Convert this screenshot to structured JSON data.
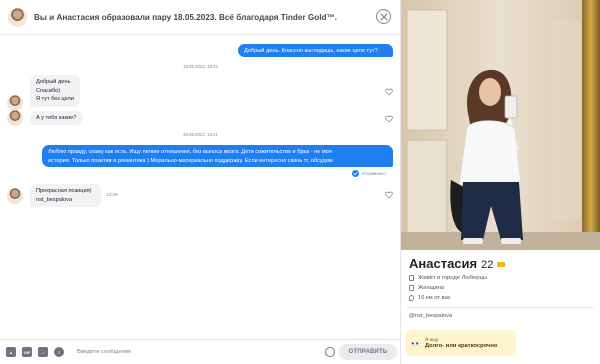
{
  "header": {
    "match_text": "Вы и Анастасия образовали пару 18.05.2023. Всё благодаря Tinder Gold™."
  },
  "messages": {
    "out_1": "Добрый день. Классно выглядишь, какие цели тут?",
    "date_1": "18.05.2023, 18:42",
    "in_1_line1": "Добрый день",
    "in_1_line2": "Спасибо)",
    "in_1_line3": "Я тут без цели",
    "in_2": "А у тебя какие?",
    "date_2": "29.05.2023, 13:41",
    "out_2_line1": "Люблю правду, скажу как есть. Ищу легкие отношения, без выноса мозга. Дети сожительство и брак - не моя",
    "out_2_line2": "история. Только позитив и романтика ) Морально-материально поддержку. Если интересно скинь тг, обсудим",
    "sent_status": "Отправлено",
    "in_3_line1": "Прекрасная позиция)",
    "in_3_line2": "nst_bespalova",
    "in_3_time": "14:29"
  },
  "composer": {
    "placeholder": "Введите сообщение",
    "send_label": "ОТПРАВИТЬ",
    "gif_label": "GIF"
  },
  "profile": {
    "name": "Анастасия",
    "age": "22",
    "city": "Живёт в городе Люберцы",
    "gender": "Женщина",
    "distance": "16 км от вас",
    "instagram": "@nst_bespalova",
    "looking_label": "Я ищу",
    "looking_value": "Долго- или краткосрочно"
  },
  "colors": {
    "accent": "#1f7ff0",
    "bubble_in": "#f0f2f4",
    "looking_bg": "#fff4cc"
  }
}
